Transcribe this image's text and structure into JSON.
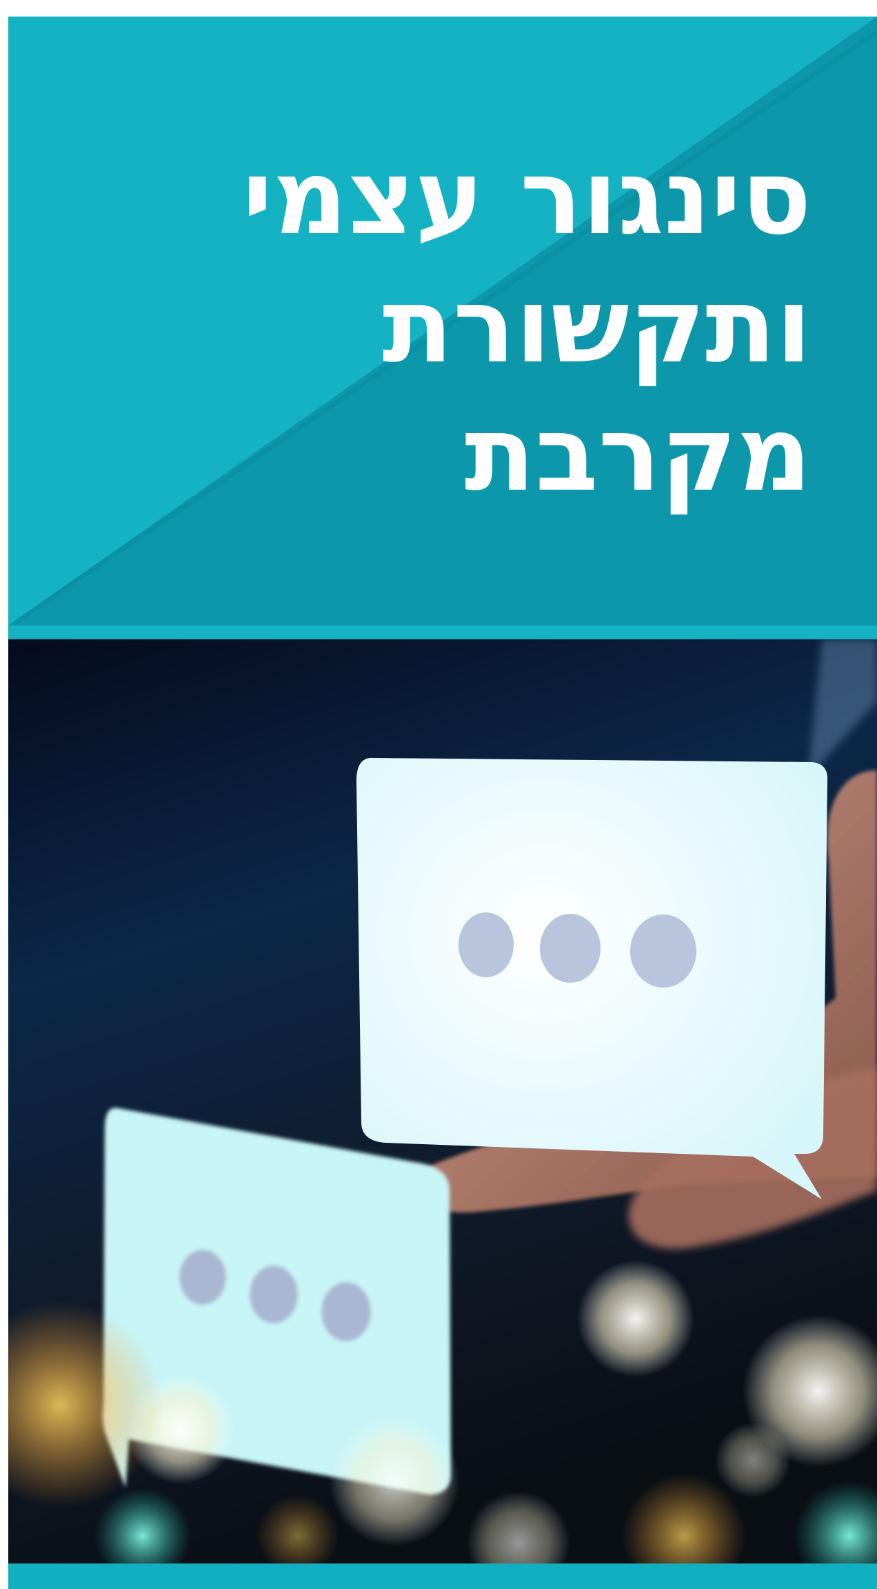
{
  "cover": {
    "title_lines": [
      "סינגור עצמי",
      "ותקשורת",
      "מקרבת"
    ],
    "colors": {
      "teal_light": "#14b2c3",
      "teal_dark": "#0c97aa",
      "white": "#ffffff",
      "photo_dark": "#0b1f3c",
      "bubble": "#eaf9fb",
      "dot": "#b9c5dd"
    },
    "photo": {
      "subject": "hand holding speech bubble cards with ellipsis dots on dark bokeh background",
      "icons": [
        "speech-bubble-icon",
        "ellipsis-icon"
      ]
    }
  }
}
